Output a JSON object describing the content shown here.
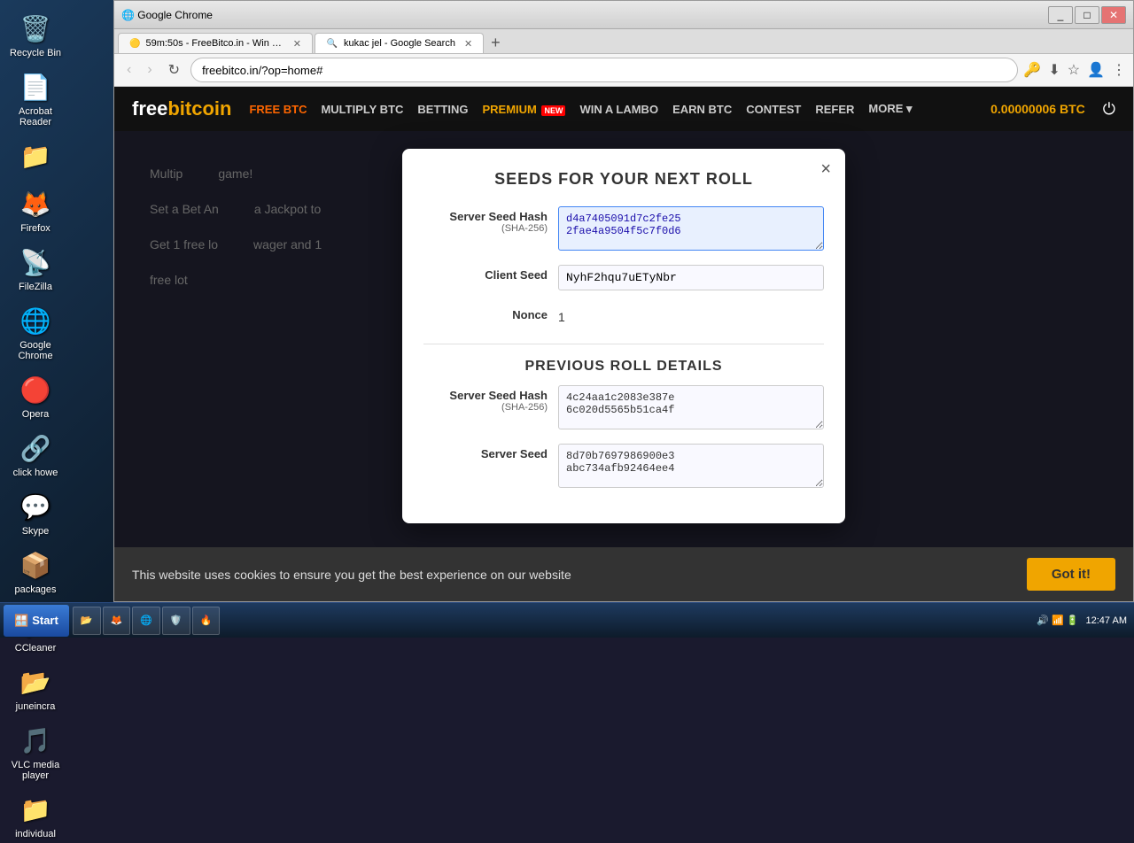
{
  "desktop": {
    "icons": [
      {
        "id": "recycle-bin",
        "label": "Recycle Bin",
        "emoji": "🗑️"
      },
      {
        "id": "acrobat",
        "label": "Acrobat Reader",
        "emoji": "📄"
      },
      {
        "id": "unknown",
        "label": "",
        "emoji": "📁"
      },
      {
        "id": "firefox",
        "label": "Firefox",
        "emoji": "🦊"
      },
      {
        "id": "filezilla",
        "label": "FileZilla",
        "emoji": "📡"
      },
      {
        "id": "chrome",
        "label": "Google Chrome",
        "emoji": "🌐"
      },
      {
        "id": "opera",
        "label": "Opera",
        "emoji": "🔴"
      },
      {
        "id": "clickhowe",
        "label": "click howe",
        "emoji": "🔗"
      },
      {
        "id": "skype",
        "label": "Skype",
        "emoji": "💬"
      },
      {
        "id": "packages",
        "label": "packages",
        "emoji": "📦"
      },
      {
        "id": "ccleaner",
        "label": "CCleaner",
        "emoji": "🧹"
      },
      {
        "id": "juneincra",
        "label": "juneincra",
        "emoji": "📂"
      },
      {
        "id": "vlc",
        "label": "VLC media player",
        "emoji": "🎵"
      },
      {
        "id": "individual",
        "label": "individual",
        "emoji": "📁"
      }
    ]
  },
  "browser": {
    "tabs": [
      {
        "id": "freebitco",
        "label": "59m:50s - FreeBitco.in - Win free bi...",
        "favicon": "🟡",
        "active": true
      },
      {
        "id": "google",
        "label": "kukac jel - Google Search",
        "favicon": "🔍",
        "active": false
      }
    ],
    "address": "freebitco.in/?op=home#",
    "new_tab_label": "+"
  },
  "nav_buttons": {
    "back": "‹",
    "forward": "›",
    "refresh": "↻"
  },
  "site": {
    "logo_free": "free",
    "logo_bitcoin": "bitcoin",
    "nav_items": [
      {
        "id": "free-btc",
        "label": "FREE BTC",
        "style": "orange"
      },
      {
        "id": "multiply",
        "label": "MULTIPLY BTC",
        "style": "normal"
      },
      {
        "id": "betting",
        "label": "BETTING",
        "style": "normal"
      },
      {
        "id": "premium",
        "label": "PREMIUM",
        "badge": "NEW",
        "style": "premium"
      },
      {
        "id": "lambo",
        "label": "WIN A LAMBO",
        "style": "normal"
      },
      {
        "id": "earn",
        "label": "EARN BTC",
        "style": "normal"
      },
      {
        "id": "contest",
        "label": "CONTEST",
        "style": "normal"
      },
      {
        "id": "refer",
        "label": "REFER",
        "style": "normal"
      },
      {
        "id": "more",
        "label": "MORE ▾",
        "style": "normal"
      }
    ],
    "balance": "0.00000006 BTC"
  },
  "modal": {
    "title": "SEEDS FOR YOUR NEXT ROLL",
    "close_label": "×",
    "server_seed_label": "Server Seed Hash",
    "server_seed_sublabel": "(SHA-256)",
    "server_seed_value": "d4a7405091d7c2fe25\n2fae4a9504f5c7f0d6",
    "client_seed_label": "Client Seed",
    "client_seed_value": "NyhF2hqu7uETyNbr",
    "nonce_label": "Nonce",
    "nonce_value": "1",
    "previous_title": "PREVIOUS ROLL DETAILS",
    "prev_server_seed_label": "Server Seed Hash",
    "prev_server_seed_sublabel": "(SHA-256)",
    "prev_server_seed_value": "4c24aa1c2083e387e\n6c020d5565b51ca4f",
    "prev_server_seed_label2": "Server Seed",
    "prev_server_seed_value2": "8d70b7697986900e3\nabc734afb92464ee4"
  },
  "cookie": {
    "text": "This website uses cookies to ensure you get the best experience on our website",
    "button_label": "Got it!"
  },
  "taskbar": {
    "start_label": "Start",
    "time": "12:47 AM",
    "items": [
      {
        "id": "explorer",
        "label": "📂"
      },
      {
        "id": "firefox-task",
        "label": "🦊"
      },
      {
        "id": "chrome-task",
        "label": "🌐"
      },
      {
        "id": "shield",
        "label": "🛡️"
      },
      {
        "id": "fire",
        "label": "🔥"
      }
    ]
  },
  "bg_text1": "Multip",
  "bg_text2": "Set a Bet An",
  "bg_text3": "Get 1 free lo",
  "bg_right1": "game!",
  "bg_right2": "a Jackpot to",
  "bg_right3": "wager and 1",
  "free_lot": "free lot"
}
